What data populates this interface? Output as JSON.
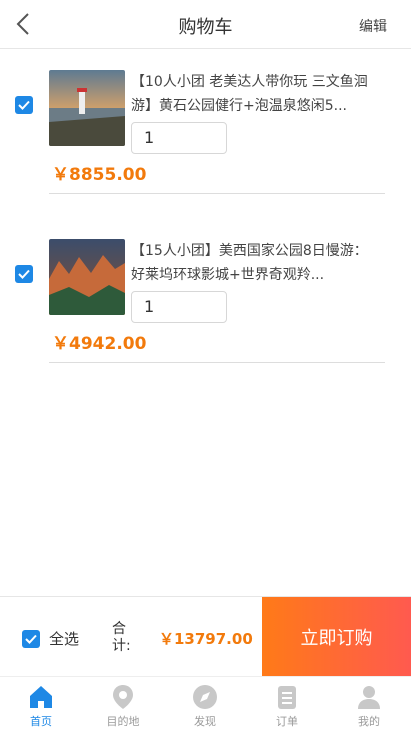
{
  "header": {
    "title": "购物车",
    "edit_label": "编辑"
  },
  "colors": {
    "accent": "#1e88e5",
    "price": "#f27a0c",
    "buy_gradient_start": "#ff7a18",
    "buy_gradient_end": "#ff5a4f"
  },
  "items": [
    {
      "name": "【10人小团 老美达人带你玩 三文鱼洄游】黄石公园健行+泡温泉悠闲5...",
      "quantity": "1",
      "price": "￥8855.00",
      "checked": true
    },
    {
      "name": "【15人小团】美西国家公园8日慢游：好莱坞环球影城+世界奇观羚...",
      "quantity": "1",
      "price": "￥4942.00",
      "checked": true
    }
  ],
  "footer": {
    "select_all_label": "全选",
    "total_label": "合计:",
    "total_value": "￥13797.00",
    "buy_label": "立即订购"
  },
  "tabbar": [
    {
      "label": "首页",
      "icon": "home-icon",
      "active": true
    },
    {
      "label": "目的地",
      "icon": "location-pin-icon",
      "active": false
    },
    {
      "label": "发现",
      "icon": "compass-icon",
      "active": false
    },
    {
      "label": "订单",
      "icon": "order-list-icon",
      "active": false
    },
    {
      "label": "我的",
      "icon": "user-icon",
      "active": false
    }
  ]
}
